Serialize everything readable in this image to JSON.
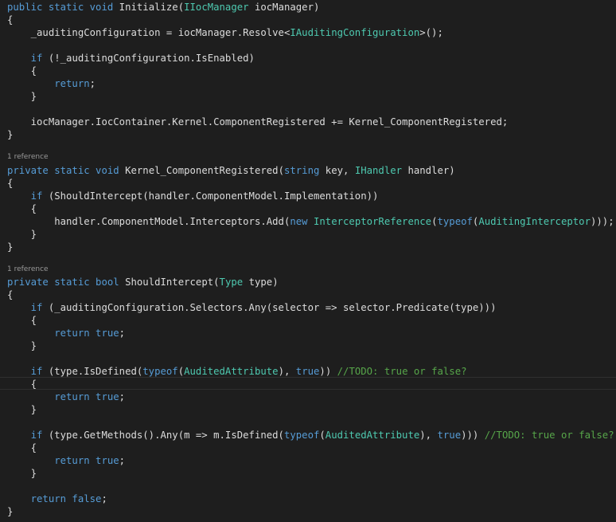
{
  "colors": {
    "background": "#1e1e1e",
    "keyword": "#569cd6",
    "type": "#4ec9b0",
    "comment": "#57a64a",
    "plain": "#dcdcdc",
    "codelens": "#999999"
  },
  "codelens": [
    {
      "text": "1 reference"
    },
    {
      "text": "1 reference"
    }
  ],
  "lines": [
    {
      "tokens": [
        {
          "k": "k",
          "t": "public static void "
        },
        {
          "k": "p",
          "t": "Initialize("
        },
        {
          "k": "t",
          "t": "IIocManager"
        },
        {
          "k": "p",
          "t": " iocManager)"
        }
      ]
    },
    {
      "tokens": [
        {
          "k": "p",
          "t": "{"
        }
      ]
    },
    {
      "tokens": [
        {
          "k": "p",
          "t": "    _auditingConfiguration = iocManager.Resolve<"
        },
        {
          "k": "t",
          "t": "IAuditingConfiguration"
        },
        {
          "k": "p",
          "t": ">();"
        }
      ]
    },
    {
      "tokens": []
    },
    {
      "tokens": [
        {
          "k": "k",
          "t": "    if"
        },
        {
          "k": "p",
          "t": " (!_auditingConfiguration.IsEnabled)"
        }
      ]
    },
    {
      "tokens": [
        {
          "k": "p",
          "t": "    {"
        }
      ]
    },
    {
      "tokens": [
        {
          "k": "k",
          "t": "        return"
        },
        {
          "k": "p",
          "t": ";"
        }
      ]
    },
    {
      "tokens": [
        {
          "k": "p",
          "t": "    }"
        }
      ]
    },
    {
      "tokens": []
    },
    {
      "tokens": [
        {
          "k": "p",
          "t": "    iocManager.IocContainer.Kernel.ComponentRegistered += Kernel_ComponentRegistered;"
        }
      ]
    },
    {
      "tokens": [
        {
          "k": "p",
          "t": "}"
        }
      ]
    },
    {
      "tokens": []
    },
    {
      "tokens": [
        {
          "k": "k",
          "t": "private static void "
        },
        {
          "k": "p",
          "t": "Kernel_ComponentRegistered("
        },
        {
          "k": "k",
          "t": "string"
        },
        {
          "k": "p",
          "t": " key, "
        },
        {
          "k": "t",
          "t": "IHandler"
        },
        {
          "k": "p",
          "t": " handler)"
        }
      ]
    },
    {
      "tokens": [
        {
          "k": "p",
          "t": "{"
        }
      ]
    },
    {
      "tokens": [
        {
          "k": "k",
          "t": "    if"
        },
        {
          "k": "p",
          "t": " (ShouldIntercept(handler.ComponentModel.Implementation))"
        }
      ]
    },
    {
      "tokens": [
        {
          "k": "p",
          "t": "    {"
        }
      ]
    },
    {
      "tokens": [
        {
          "k": "p",
          "t": "        handler.ComponentModel.Interceptors.Add("
        },
        {
          "k": "k",
          "t": "new "
        },
        {
          "k": "t",
          "t": "InterceptorReference"
        },
        {
          "k": "p",
          "t": "("
        },
        {
          "k": "k",
          "t": "typeof"
        },
        {
          "k": "p",
          "t": "("
        },
        {
          "k": "t",
          "t": "AuditingInterceptor"
        },
        {
          "k": "p",
          "t": ")));"
        }
      ]
    },
    {
      "tokens": [
        {
          "k": "p",
          "t": "    }"
        }
      ]
    },
    {
      "tokens": [
        {
          "k": "p",
          "t": "}"
        }
      ]
    },
    {
      "tokens": []
    },
    {
      "tokens": [
        {
          "k": "k",
          "t": "private static bool "
        },
        {
          "k": "p",
          "t": "ShouldIntercept("
        },
        {
          "k": "t",
          "t": "Type"
        },
        {
          "k": "p",
          "t": " type)"
        }
      ]
    },
    {
      "tokens": [
        {
          "k": "p",
          "t": "{"
        }
      ]
    },
    {
      "tokens": [
        {
          "k": "k",
          "t": "    if"
        },
        {
          "k": "p",
          "t": " (_auditingConfiguration.Selectors.Any(selector => selector.Predicate(type)))"
        }
      ]
    },
    {
      "tokens": [
        {
          "k": "p",
          "t": "    {"
        }
      ]
    },
    {
      "tokens": [
        {
          "k": "k",
          "t": "        return true"
        },
        {
          "k": "p",
          "t": ";"
        }
      ]
    },
    {
      "tokens": [
        {
          "k": "p",
          "t": "    }"
        }
      ]
    },
    {
      "tokens": []
    },
    {
      "tokens": [
        {
          "k": "k",
          "t": "    if"
        },
        {
          "k": "p",
          "t": " (type.IsDefined("
        },
        {
          "k": "k",
          "t": "typeof"
        },
        {
          "k": "p",
          "t": "("
        },
        {
          "k": "t",
          "t": "AuditedAttribute"
        },
        {
          "k": "p",
          "t": "), "
        },
        {
          "k": "k",
          "t": "true"
        },
        {
          "k": "p",
          "t": ")) "
        },
        {
          "k": "c",
          "t": "//TODO: true or false?"
        }
      ]
    },
    {
      "tokens": [
        {
          "k": "p",
          "t": "    {"
        }
      ]
    },
    {
      "tokens": [
        {
          "k": "k",
          "t": "        return true"
        },
        {
          "k": "p",
          "t": ";"
        }
      ]
    },
    {
      "tokens": [
        {
          "k": "p",
          "t": "    }"
        }
      ]
    },
    {
      "tokens": []
    },
    {
      "tokens": [
        {
          "k": "k",
          "t": "    if"
        },
        {
          "k": "p",
          "t": " (type.GetMethods().Any(m => m.IsDefined("
        },
        {
          "k": "k",
          "t": "typeof"
        },
        {
          "k": "p",
          "t": "("
        },
        {
          "k": "t",
          "t": "AuditedAttribute"
        },
        {
          "k": "p",
          "t": "), "
        },
        {
          "k": "k",
          "t": "true"
        },
        {
          "k": "p",
          "t": "))) "
        },
        {
          "k": "c",
          "t": "//TODO: true or false?"
        }
      ]
    },
    {
      "tokens": [
        {
          "k": "p",
          "t": "    {"
        }
      ]
    },
    {
      "tokens": [
        {
          "k": "k",
          "t": "        return true"
        },
        {
          "k": "p",
          "t": ";"
        }
      ]
    },
    {
      "tokens": [
        {
          "k": "p",
          "t": "    }"
        }
      ]
    },
    {
      "tokens": []
    },
    {
      "tokens": [
        {
          "k": "k",
          "t": "    return false"
        },
        {
          "k": "p",
          "t": ";"
        }
      ]
    },
    {
      "tokens": [
        {
          "k": "p",
          "t": "}"
        }
      ]
    }
  ]
}
